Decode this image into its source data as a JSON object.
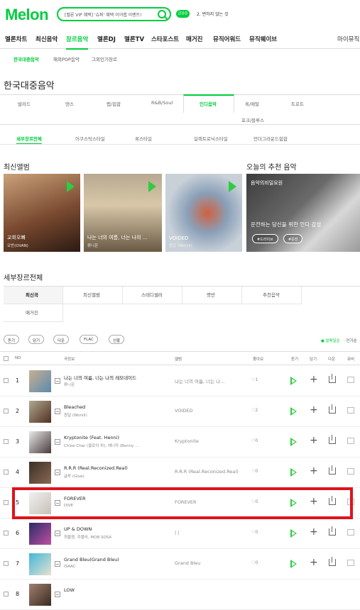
{
  "header": {
    "logo": "Melon",
    "search_placeholder": "[멜론 VIP 혜택] '슈퍼' 혜택 이어랩 이벤트!",
    "badge": "급상승",
    "notice": "2. 변하지 않는 것 ",
    "accent": "#00cd3c"
  },
  "gnb": [
    "멜론차트",
    "최신음악",
    "장르음악",
    "멜론DJ",
    "멜론TV",
    "스타포스트",
    "매거진",
    "뮤직어워드",
    "뮤직웨이브"
  ],
  "gnb_my": "마이뮤직",
  "subnav": [
    "한국대중음악",
    "해외POP음악",
    "그외인기장르"
  ],
  "page_title": "한국대중음악",
  "genres": [
    "발라드",
    "댄스",
    "랩/힙합",
    "R&B/Soul",
    "인디음악",
    "록/메탈",
    "트로트",
    "포크/블루스"
  ],
  "subgenres": [
    "세부장르전체",
    "어쿠스틱스타일",
    "록스타일",
    "일렉트로닉스타일",
    "언더그라운드힙합"
  ],
  "section_new": "최신앨범",
  "section_rec": "오늘의 추천 음악",
  "albums": [
    {
      "title": "교회오빠",
      "artist": "오반(OVAN)"
    },
    {
      "title": "나는 너의 여름, 너는 나의 ...",
      "artist": "류니온"
    },
    {
      "title": "VOIDED",
      "artist": "원일 (Wonill)"
    }
  ],
  "recommend": {
    "label": "음악의비밀요원",
    "desc": "운전하는 당신을 위한 인디 감성",
    "tags": [
      "#드라이브",
      "#운전"
    ]
  },
  "section_all": "세부장르전체",
  "filter_tabs": [
    "최신곡",
    "최신앨범",
    "스테디셀러",
    "명반",
    "추천음악",
    "매거진"
  ],
  "tools": [
    "듣기",
    "담기",
    "다운",
    "FLAC",
    "선물"
  ],
  "sorts": [
    "● 발매일순",
    "· 인기순"
  ],
  "columns": {
    "no": "NO",
    "song": "곡정보",
    "album": "앨범",
    "like": "좋아요",
    "listen": "듣기",
    "add": "담기",
    "down": "다운",
    "mv": "뮤비"
  },
  "songs": [
    {
      "no": "1",
      "title": "나는 너의 여름, 너는 나의 레모네이드",
      "artist": "류니온",
      "album": "나는 너의 여름, 너는 나...",
      "like": "1"
    },
    {
      "no": "2",
      "title": "Bleached",
      "artist": "원일 (Wonill)",
      "album": "VOIDED",
      "like": "2"
    },
    {
      "no": "3",
      "title": "Kryptonite (Feat. Henni)",
      "artist": "Chloe Char (클로이 차), 헤니자 (Benny ...",
      "album": "Kryptonite",
      "like": "0"
    },
    {
      "no": "4",
      "title": "R.R.R (Real.Reconized.Real)",
      "artist": "글루 (Glue)",
      "album": "R.R.R (Real.Reconized.Real)",
      "like": "0"
    },
    {
      "no": "5",
      "title": "FOREVER",
      "artist": "DIVE",
      "album": "FOREVER",
      "like": "0"
    },
    {
      "no": "6",
      "title": "UP & DOWN",
      "artist": "최율쟁, 주블러, MOB SOSA",
      "album": "| |",
      "like": "0"
    },
    {
      "no": "7",
      "title": "Grand Bleu(Grand Bleu)",
      "artist": "ISAAC",
      "album": "Grand Bleu",
      "like": "0"
    },
    {
      "no": "8",
      "title": "LOW",
      "artist": "",
      "album": "",
      "like": ""
    }
  ]
}
